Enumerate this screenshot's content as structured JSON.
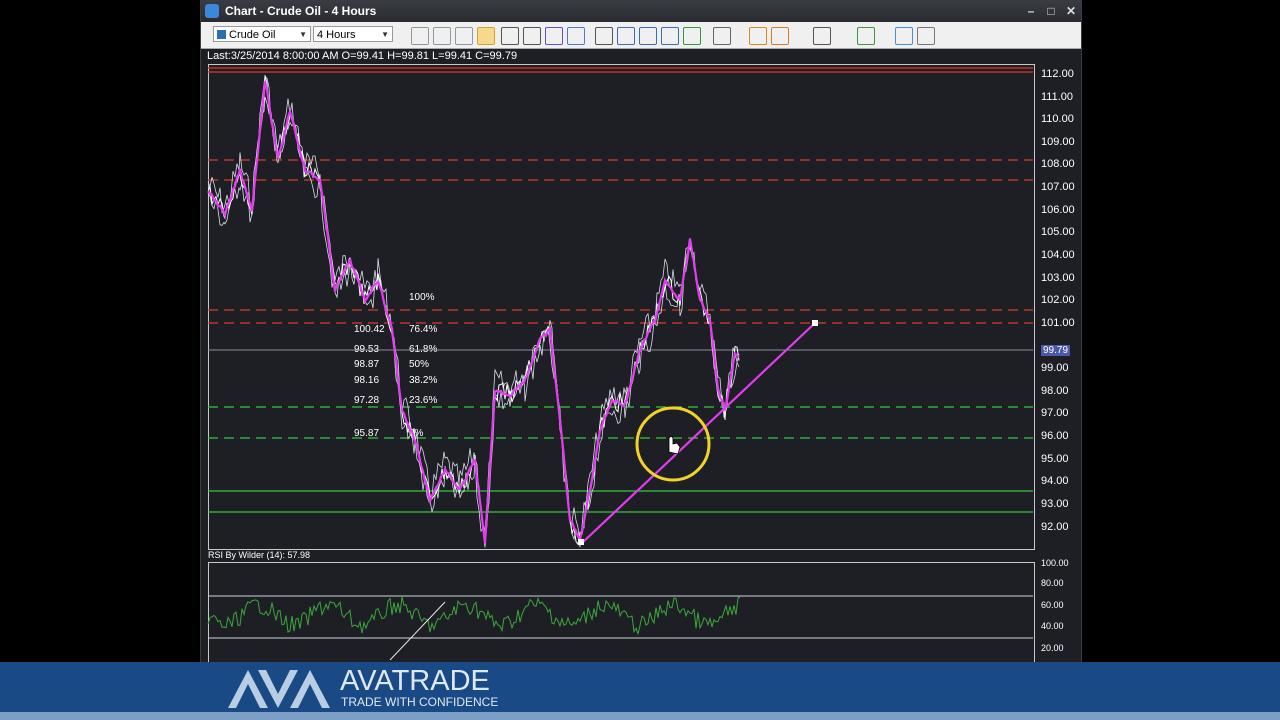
{
  "window": {
    "title": "Chart - Crude Oil - 4 Hours",
    "controls": [
      "–",
      "□",
      "✕"
    ]
  },
  "toolbar": {
    "symbol": "Crude Oil",
    "timeframe": "4 Hours",
    "icons": [
      "zoom-in-icon",
      "zoom-out-icon",
      "zoom-reset-icon",
      "cursor-icon",
      "crosshair-icon",
      "draw-line-icon",
      "indicator-icon",
      "template-icon",
      "print-icon",
      "save-icon",
      "export-icon",
      "image-icon",
      "excel-icon",
      "grid-icon",
      "link-icon",
      "settings-icon",
      "line-style-icon",
      "chart-type-icon",
      "copy-icon",
      "tools-icon"
    ]
  },
  "info": {
    "last_bar": "Last:3/25/2014 8:00:00 AM O=99.41 H=99.81 L=99.41 C=99.79"
  },
  "main_chart": {
    "y_axis_labels": [
      "112.00",
      "111.00",
      "110.00",
      "109.00",
      "108.00",
      "107.00",
      "106.00",
      "105.00",
      "104.00",
      "103.00",
      "102.00",
      "101.00",
      "99.00",
      "98.00",
      "97.00",
      "96.00",
      "95.00",
      "94.00",
      "93.00",
      "92.00"
    ],
    "last_price_tag": "99.79",
    "fibonacci": [
      {
        "price": "",
        "pct": "100%"
      },
      {
        "price": "100.42",
        "pct": "76.4%"
      },
      {
        "price": "99.53",
        "pct": "61.8%"
      },
      {
        "price": "98.87",
        "pct": "50%"
      },
      {
        "price": "98.16",
        "pct": "38.2%"
      },
      {
        "price": "97.28",
        "pct": "23.6%"
      },
      {
        "price": "95.87",
        "pct": "0%"
      }
    ],
    "colors": {
      "price": "#ffffff",
      "ma": "#e23cf0",
      "red_levels": "#d93a2b",
      "green_levels": "#37c83c",
      "trend": "#e23cf0",
      "cursor_ring": "#f2d22a"
    }
  },
  "rsi": {
    "title": "RSI By Wilder (14): 57.98",
    "y_axis_labels": [
      "100.00",
      "80.00",
      "60.00",
      "40.00",
      "20.00"
    ],
    "color": "#3aa83a"
  },
  "brand": {
    "name": "AVATRADE",
    "tagline": "TRADE WITH CONFIDENCE"
  }
}
